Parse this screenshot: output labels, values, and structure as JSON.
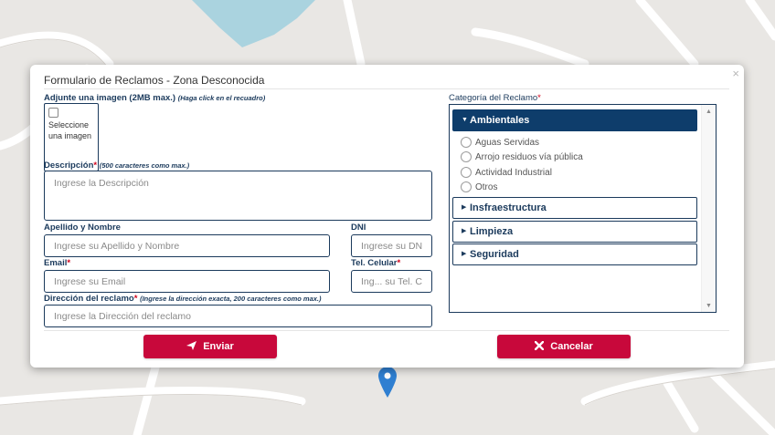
{
  "modal": {
    "title": "Formulario de Reclamos - Zona Desconocida",
    "close_glyph": "×"
  },
  "image_upload": {
    "label": "Adjunte una imagen (2MB max.)",
    "hint": "(Haga click en el recuadro)",
    "box_text": "Seleccione una imagen"
  },
  "description": {
    "label": "Descripción",
    "required_mark": "*",
    "hint": "(500 caracteres como max.)",
    "placeholder": "Ingrese la Descripción"
  },
  "name": {
    "label": "Apellido y Nombre",
    "placeholder": "Ingrese su Apellido y Nombre"
  },
  "dni": {
    "label": "DNI",
    "placeholder": "Ingrese su DNI"
  },
  "email": {
    "label": "Email",
    "required_mark": "*",
    "placeholder": "Ingrese su Email"
  },
  "phone": {
    "label": "Tel. Celular",
    "required_mark": "*",
    "placeholder": "Ing... su Tel. Cel"
  },
  "address": {
    "label": "Dirección del reclamo",
    "required_mark": "*",
    "hint": "(Ingrese la dirección exacta, 200 caracteres como max.)",
    "placeholder": "Ingrese la Dirección del reclamo"
  },
  "category": {
    "label": "Categoría del Reclamo",
    "required_mark": "*",
    "groups": [
      {
        "name": "Ambientales",
        "expanded": true,
        "options": [
          "Aguas Servidas",
          "Arrojo residuos vía pública",
          "Actividad Industrial",
          "Otros"
        ]
      },
      {
        "name": "Insfraestructura",
        "expanded": false
      },
      {
        "name": "Limpieza",
        "expanded": false
      },
      {
        "name": "Seguridad",
        "expanded": false
      }
    ],
    "caret_expanded": "▼",
    "caret_collapsed": "▶",
    "scroll_up": "▲",
    "scroll_down": "▼"
  },
  "buttons": {
    "submit_label": "Enviar",
    "cancel_label": "Cancelar"
  },
  "colors": {
    "accent_red": "#c8083b",
    "navy": "#0e3d6b",
    "label_blue": "#1b3a5c",
    "pin_blue": "#2f7fd1"
  }
}
